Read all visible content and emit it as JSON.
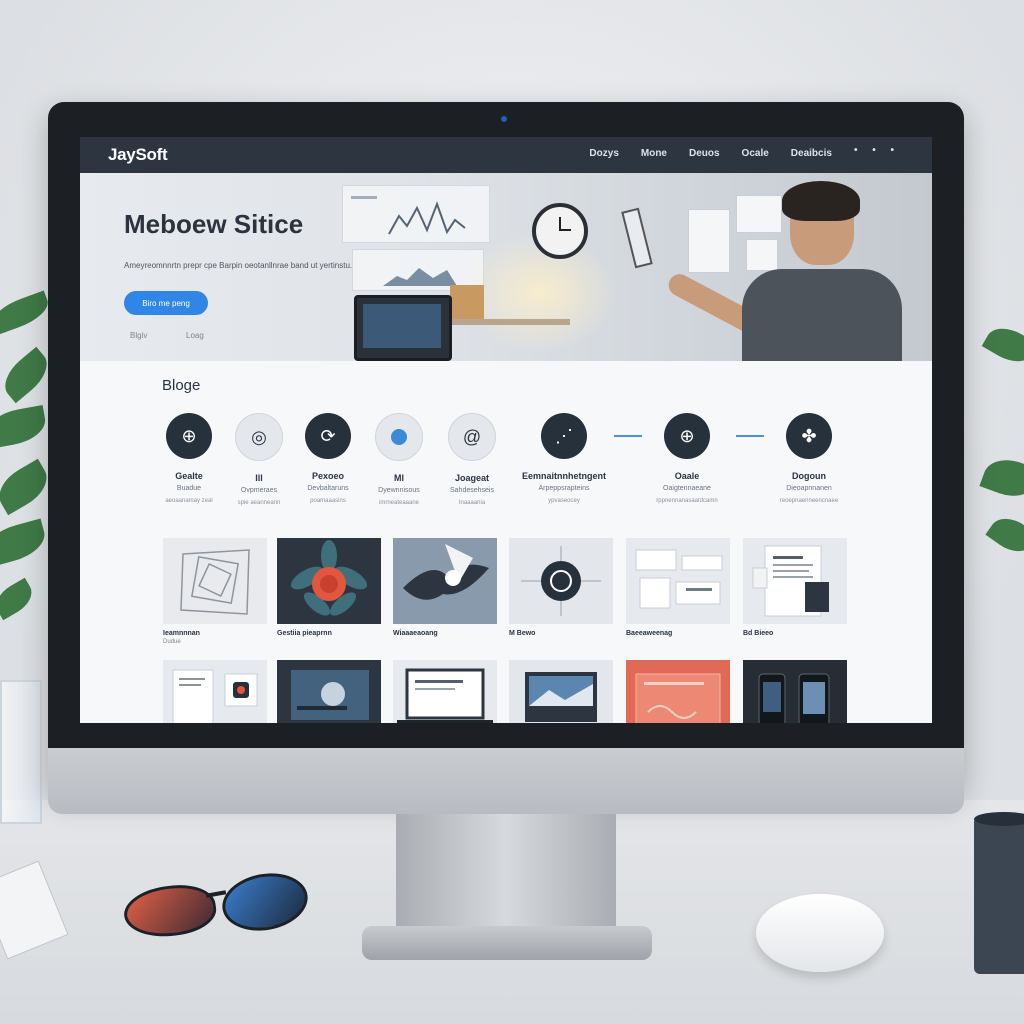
{
  "brand": "JaySoft",
  "nav": {
    "links": [
      "Dozys",
      "Mone",
      "Deuos",
      "Ocale",
      "Deaibcis"
    ],
    "more": "• • •"
  },
  "hero": {
    "title": "Meboew Sitice",
    "subtitle": "Ameyreomnnrtn prepr cpe Barpin oeotanllnrae band ut yertinstu.",
    "button": "Biro me peng",
    "links": [
      "Blgiv",
      "Loag"
    ]
  },
  "blogs": {
    "title": "Bloge",
    "categories": [
      {
        "name": "Gealte",
        "desc": "Buadue",
        "desc2": "aeoaanamay zeal",
        "icon": "globe-icon",
        "style": "dark"
      },
      {
        "name": "Ill",
        "desc": "Ovpmeraes",
        "desc2": "spie aeanneann",
        "icon": "swirl-icon",
        "style": "light"
      },
      {
        "name": "Pexoeo",
        "desc": "Devbaltaruns",
        "desc2": "poamaaasins",
        "icon": "orbit-icon",
        "style": "dark"
      },
      {
        "name": "Ml",
        "desc": "Dyewnnisous",
        "desc2": "imrneateaaane",
        "icon": "circle-icon",
        "style": "light"
      },
      {
        "name": "Joageat",
        "desc": "Sahdesehseis",
        "desc2": "Inaaaania",
        "icon": "spiral-icon",
        "style": "light"
      },
      {
        "name": "Eemnaitnnhetngent",
        "desc": "Arpeppsrapteins",
        "desc2": "ypvaseocey",
        "icon": "chart-icon",
        "style": "dark"
      },
      {
        "name": "Oaale",
        "desc": "Oaigtennaeane",
        "desc2": "rppnennanasaatdcamn",
        "icon": "globe-icon",
        "style": "dark"
      },
      {
        "name": "Dogoun",
        "desc": "Dieoapnnanen",
        "desc2": "reoepnaenneencnaee",
        "icon": "flower-icon",
        "style": "dark"
      }
    ],
    "cards_row1": [
      {
        "label": "Ieamnnnan",
        "sub": "Dudue",
        "theme": "geo"
      },
      {
        "label": "Gestiia pieaprnn",
        "sub": "",
        "theme": "rose"
      },
      {
        "label": "Wiaaaeaoang",
        "sub": "",
        "theme": "bird"
      },
      {
        "label": "M Bewo",
        "sub": "",
        "theme": "target"
      },
      {
        "label": "Baeeaweenag",
        "sub": "",
        "theme": "ui"
      },
      {
        "label": "Bd Bieeo",
        "sub": "",
        "theme": "doc"
      }
    ],
    "cards_row2": [
      {
        "theme": "light-doc"
      },
      {
        "theme": "dark-screen"
      },
      {
        "theme": "laptop"
      },
      {
        "theme": "blue-screen"
      },
      {
        "theme": "coral"
      },
      {
        "theme": "phones"
      }
    ]
  },
  "colors": {
    "nav_bg": "#2c3540",
    "accent": "#2f86e6",
    "dark_icon": "#27313c"
  }
}
